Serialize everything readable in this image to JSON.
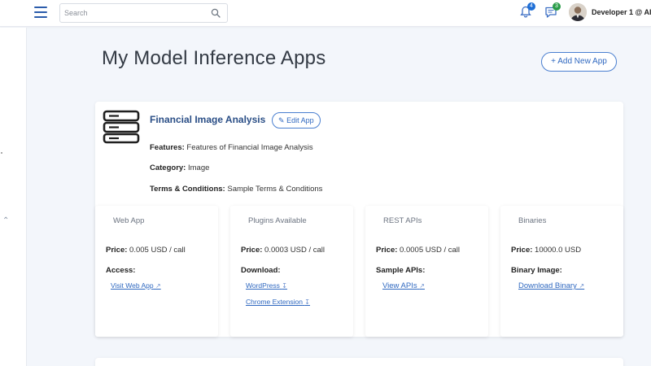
{
  "header": {
    "search_placeholder": "Search",
    "notifications_count": "4",
    "messages_count": "3",
    "username": "Developer 1 @ AI"
  },
  "page": {
    "title": "My Model Inference Apps",
    "add_button_label": "+ Add New App"
  },
  "app": {
    "name": "Financial Image Analysis",
    "edit_label": "Edit App",
    "features_label": "Features:",
    "features_value": "Features of Financial Image Analysis",
    "category_label": "Category:",
    "category_value": "Image",
    "terms_label": "Terms & Conditions:",
    "terms_value": "Sample Terms & Conditions"
  },
  "panels": [
    {
      "title": "Web App",
      "price_label": "Price:",
      "price_value": "0.005 USD / call",
      "access_label": "Access:",
      "links": [
        "Visit Web App"
      ]
    },
    {
      "title": "Plugins Available",
      "price_label": "Price:",
      "price_value": "0.0003 USD / call",
      "access_label": "Download:",
      "links": [
        "WordPress",
        "Chrome Extension"
      ]
    },
    {
      "title": "REST APIs",
      "price_label": "Price:",
      "price_value": "0.0005 USD / call",
      "access_label": "Sample APIs:",
      "links": [
        "View APIs"
      ]
    },
    {
      "title": "Binaries",
      "price_label": "Price:",
      "price_value": "10000.0 USD",
      "access_label": "Binary Image:",
      "links": [
        "Download Binary"
      ]
    }
  ],
  "colors": {
    "accent": "#2f68c0",
    "app_name": "#2a4e86",
    "background": "#f3f6fb"
  }
}
